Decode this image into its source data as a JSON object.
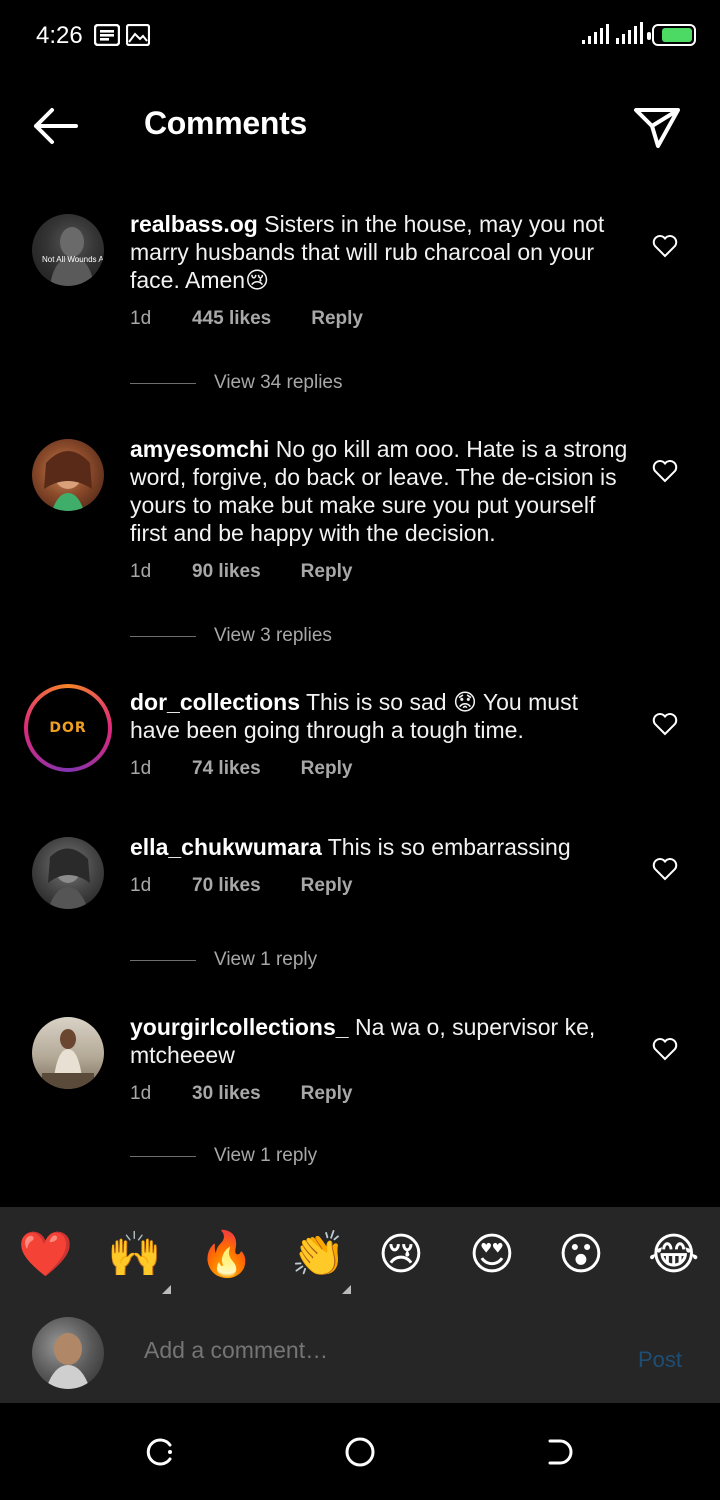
{
  "status_bar": {
    "time": "4:26"
  },
  "header": {
    "title": "Comments"
  },
  "comments": [
    {
      "user": "realbass.og",
      "text": "Sisters in the house, may you not marry husbands that will rub charcoal on your face. Amen😢",
      "time": "1d",
      "likes": "445 likes",
      "reply": "Reply",
      "view_replies": "View 34 replies",
      "avatar_caption": "Not All Wounds Are Visible."
    },
    {
      "user": "amyesomchi",
      "text": "No go kill am ooo. Hate is a strong word, forgive, do back or leave. The de-cision is yours to make but make sure you put yourself first and be happy with the decision.",
      "time": "1d",
      "likes": "90 likes",
      "reply": "Reply",
      "view_replies": "View 3 replies"
    },
    {
      "user": "dor_collections",
      "text": "This is so sad 😟 You must have been going through a tough time.",
      "time": "1d",
      "likes": "74 likes",
      "reply": "Reply",
      "avatar_logo": "DOR"
    },
    {
      "user": "ella_chukwumara",
      "text": "This is so embarrassing",
      "time": "1d",
      "likes": "70 likes",
      "reply": "Reply",
      "view_replies": "View 1 reply"
    },
    {
      "user": "yourgirlcollections_",
      "text": "Na wa o, supervisor ke, mtcheeew",
      "time": "1d",
      "likes": "30 likes",
      "reply": "Reply",
      "view_replies": "View 1 reply"
    }
  ],
  "emoji_bar": [
    "❤️",
    "🙌",
    "🔥",
    "👏",
    "😢",
    "😍",
    "😮",
    "😂"
  ],
  "comment_input": {
    "placeholder": "Add a comment…",
    "post_label": "Post"
  },
  "colors": {
    "background": "#000000",
    "bar": "#262626",
    "post_disabled": "#1f4e75",
    "meta": "#a8a8a8"
  }
}
